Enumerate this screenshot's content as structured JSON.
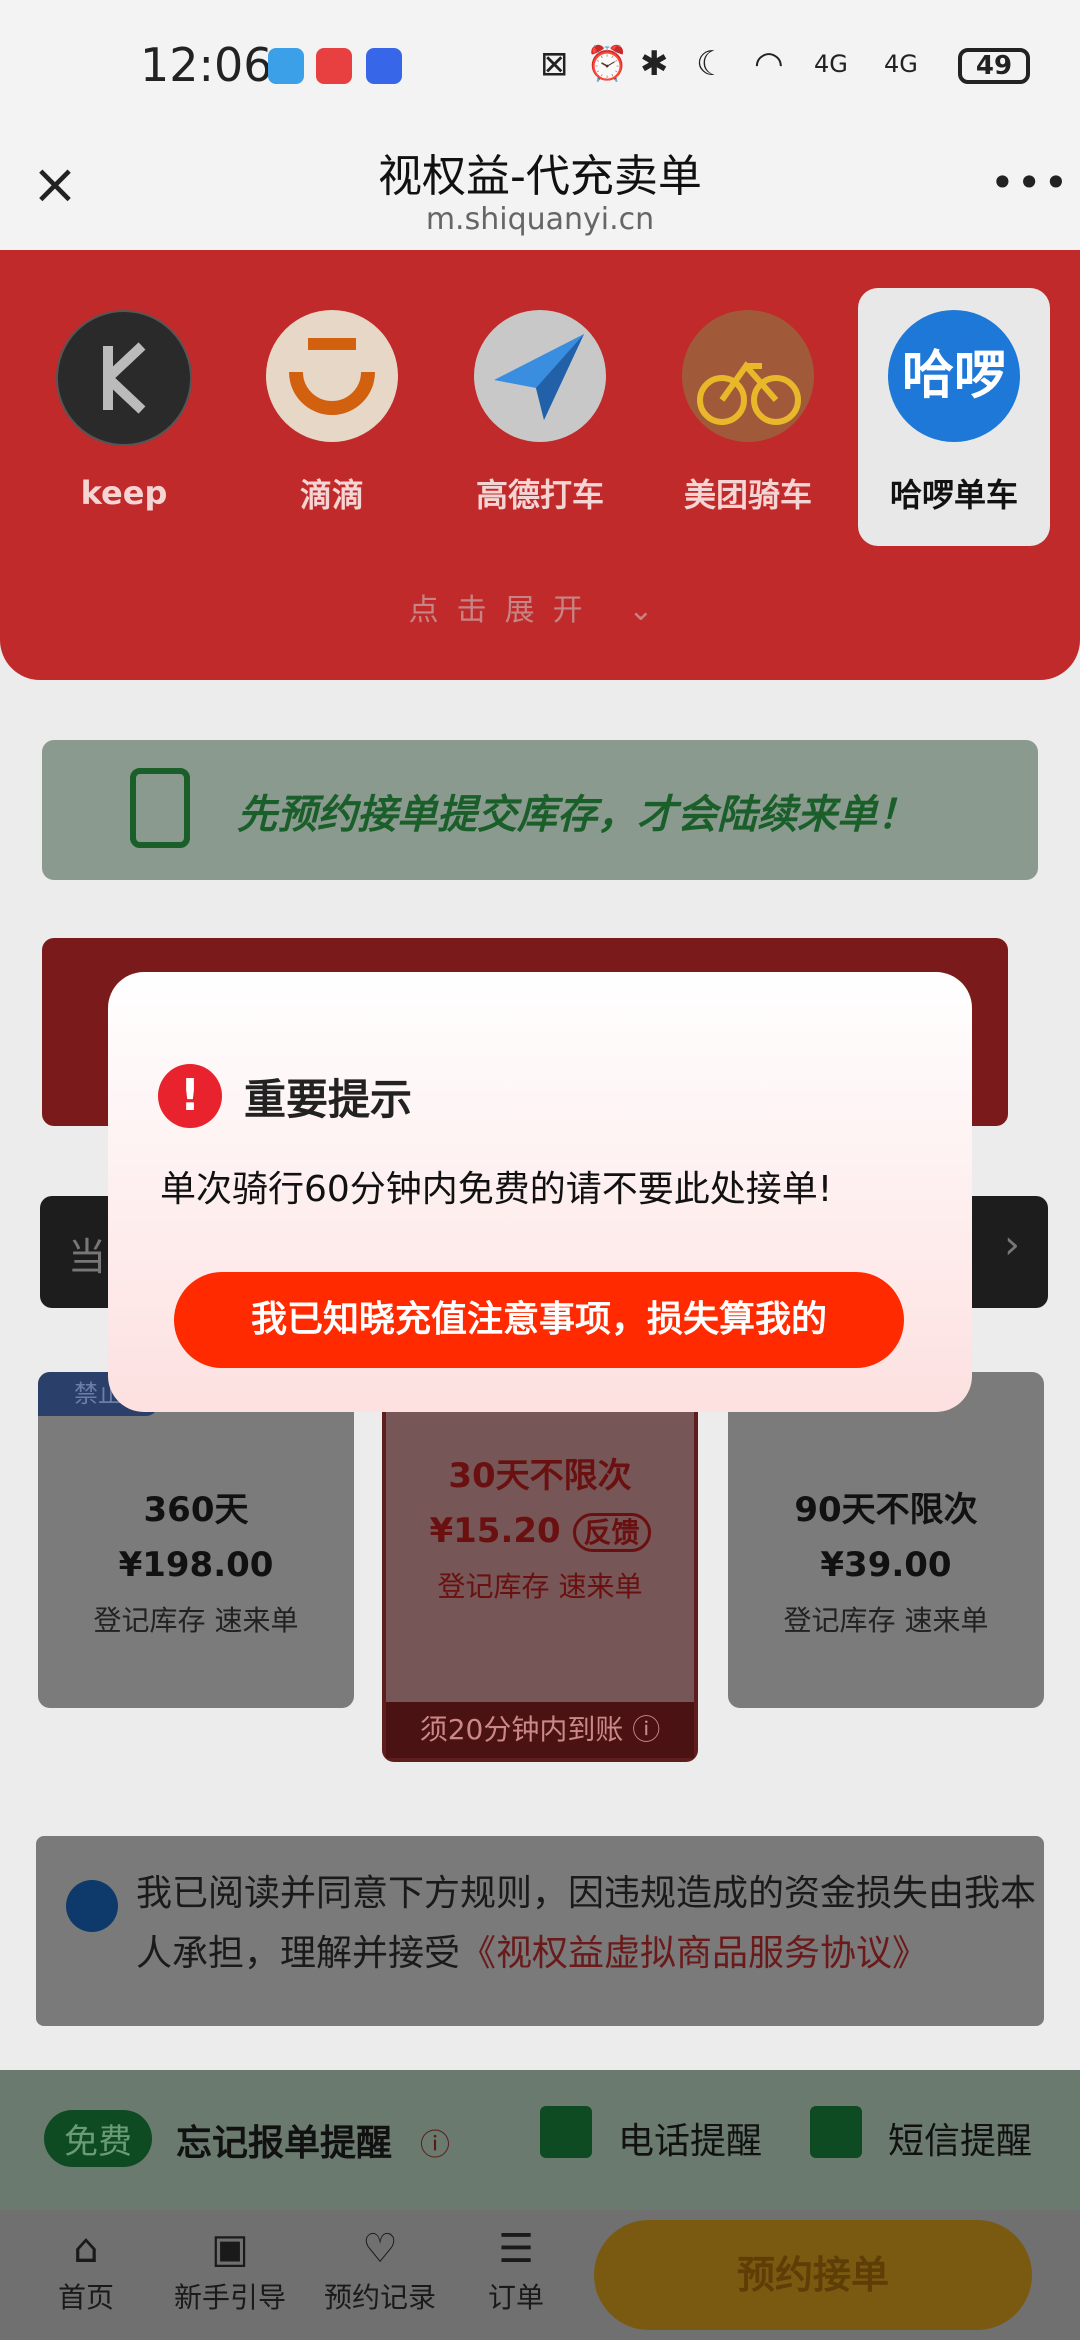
{
  "status_bar": {
    "time": "12:06",
    "network": "4G",
    "battery": "49"
  },
  "header": {
    "title": "视权益-代充卖单",
    "url": "m.shiquanyi.cn"
  },
  "brands": [
    {
      "label": "keep",
      "icon": "keep-logo"
    },
    {
      "label": "滴滴",
      "icon": "didi-logo"
    },
    {
      "label": "高德打车",
      "icon": "amap-plane-logo"
    },
    {
      "label": "美团骑车",
      "icon": "meituan-bike-logo"
    },
    {
      "label": "哈啰单车",
      "icon": "hello-logo"
    }
  ],
  "expand_label": "点击展开",
  "notice": "先预约接单提交库存，才会陆续来单！",
  "cards": [
    {
      "title": "360天",
      "price": "¥198.00",
      "subtitle": "登记库存 速来单",
      "tag": "禁止"
    },
    {
      "title": "30天不限次",
      "price": "¥15.20",
      "feedback": "反馈",
      "subtitle": "登记库存 速来单",
      "footer": "须20分钟内到账"
    },
    {
      "title": "90天不限次",
      "price": "¥39.00",
      "subtitle": "登记库存 速来单"
    }
  ],
  "dark_bar_prefix": "当",
  "agreement": {
    "text": "我已阅读并同意下方规则，因违规造成的资金损失由我本人承担，理解并接受",
    "link": "《视权益虚拟商品服务协议》"
  },
  "reminder": {
    "badge": "免费",
    "label": "忘记报单提醒",
    "phone": "电话提醒",
    "sms": "短信提醒"
  },
  "bottom_nav": [
    {
      "label": "首页"
    },
    {
      "label": "新手引导"
    },
    {
      "label": "预约记录"
    },
    {
      "label": "订单"
    }
  ],
  "reserve_button": "预约接单",
  "dialog": {
    "title": "重要提示",
    "message": "单次骑行60分钟内免费的请不要此处接单!",
    "confirm": "我已知晓充值注意事项，损失算我的"
  },
  "colors": {
    "primary_red": "#c12a2a",
    "button_red": "#ff2a00",
    "warning": "#e8232d"
  }
}
